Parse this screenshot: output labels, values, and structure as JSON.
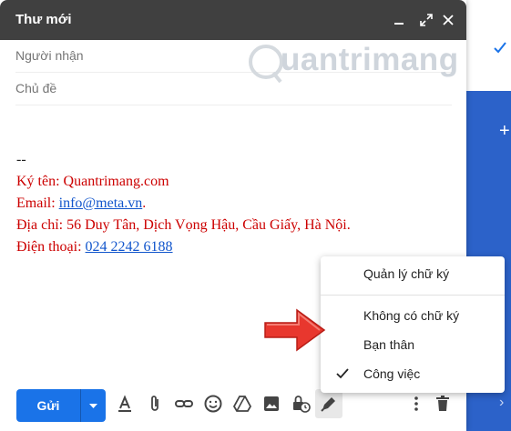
{
  "compose": {
    "title": "Thư mới",
    "to_placeholder": "Người nhận",
    "subject_placeholder": "Chủ đề"
  },
  "signature": {
    "dashes": "--",
    "name_line": "Ký tên: Quantrimang.com",
    "email_label": "Email: ",
    "email_link": "info@meta.vn",
    "email_end": ".",
    "address_line": "Địa chỉ: 56 Duy Tân, Dịch Vọng Hậu, Cầu Giấy, Hà Nội.",
    "phone_label": "Điện thoại: ",
    "phone_link": "024 2242 6188"
  },
  "watermark": {
    "text": "uantrimang"
  },
  "toolbar": {
    "send_label": "Gửi"
  },
  "signature_menu": {
    "manage": "Quản lý chữ ký",
    "items": [
      "Không có chữ ký",
      "Bạn thân",
      "Công việc"
    ],
    "checked_index": 2
  },
  "colors": {
    "accent": "#1a73e8",
    "signature_red": "#cc0000",
    "arrow_red": "#e8372e"
  }
}
